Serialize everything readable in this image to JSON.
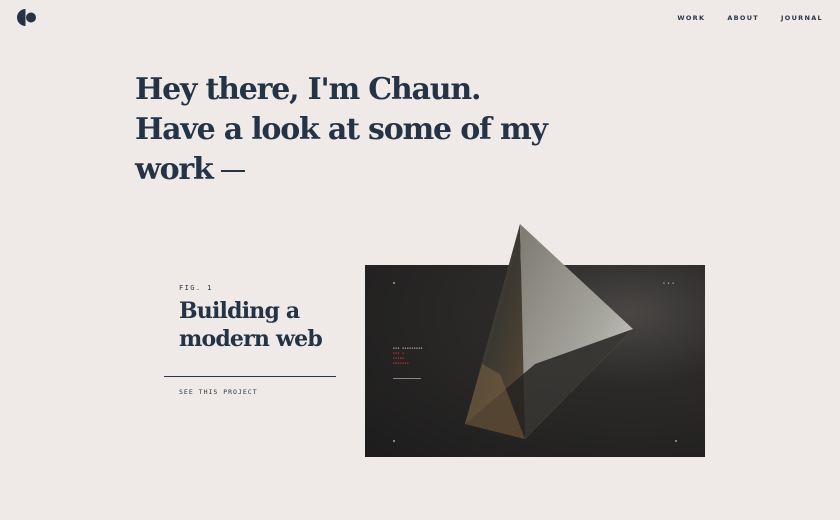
{
  "nav": {
    "items": [
      {
        "label": "WORK"
      },
      {
        "label": "ABOUT"
      },
      {
        "label": "JOURNAL"
      }
    ]
  },
  "logo": {
    "icon": "monogram-logo-icon"
  },
  "hero": {
    "headline": "Hey there, I'm Chaun. Have a look at some of my work"
  },
  "project": {
    "fig_label": "FIG. 1",
    "title": "Building a modern web",
    "cta": "SEE THIS PROJECT"
  },
  "colors": {
    "background": "#efe9e7",
    "text": "#243446",
    "accent_red": "#c0392b"
  }
}
